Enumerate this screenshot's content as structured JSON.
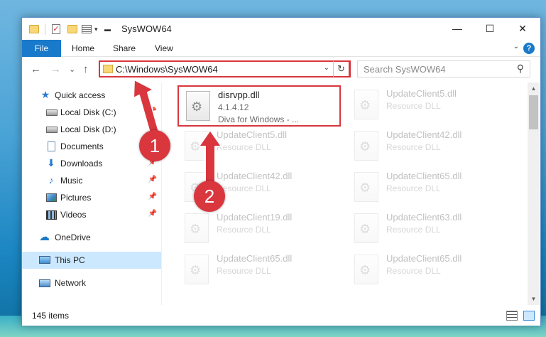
{
  "window": {
    "title": "SysWOW64",
    "minimize_glyph": "—",
    "maximize_glyph": "☐",
    "close_glyph": "✕"
  },
  "ribbon": {
    "tabs": [
      "File",
      "Home",
      "Share",
      "View"
    ],
    "help_glyph": "?",
    "collapse_glyph": "⌄"
  },
  "nav": {
    "back_glyph": "←",
    "forward_glyph": "→",
    "recent_glyph": "⌄",
    "up_glyph": "↑",
    "address": "C:\\Windows\\SysWOW64",
    "address_dropdown_glyph": "⌄",
    "refresh_glyph": "↻",
    "search_placeholder": "Search SysWOW64",
    "search_glyph": "⚲"
  },
  "sidebar": {
    "items": [
      {
        "label": "Quick access",
        "icon": "star-icon",
        "glyph": "★",
        "pinned": false
      },
      {
        "label": "Local Disk (C:)",
        "icon": "drive-icon",
        "glyph": "",
        "pinned": true
      },
      {
        "label": "Local Disk (D:)",
        "icon": "drive-icon",
        "glyph": "",
        "pinned": false
      },
      {
        "label": "Documents",
        "icon": "document-icon",
        "glyph": "",
        "pinned": false
      },
      {
        "label": "Downloads",
        "icon": "download-icon",
        "glyph": "⬇",
        "pinned": true
      },
      {
        "label": "Music",
        "icon": "music-icon",
        "glyph": "♪",
        "pinned": true
      },
      {
        "label": "Pictures",
        "icon": "pictures-icon",
        "glyph": "",
        "pinned": true
      },
      {
        "label": "Videos",
        "icon": "videos-icon",
        "glyph": "",
        "pinned": true
      },
      {
        "label": "OneDrive",
        "icon": "cloud-icon",
        "glyph": "☁",
        "pinned": false
      },
      {
        "label": "This PC",
        "icon": "computer-icon",
        "glyph": "",
        "pinned": false,
        "selected": true
      },
      {
        "label": "Network",
        "icon": "network-icon",
        "glyph": "",
        "pinned": false
      }
    ],
    "pin_glyph": "📌"
  },
  "files": [
    {
      "name": "disrvpp.dll",
      "line2": "4.1.4.12",
      "line3": "Diva for Windows - ...",
      "highlighted": true
    },
    {
      "name": "UpdateClient5.dll",
      "line2": "Resource DLL",
      "line3": ""
    },
    {
      "name": "UpdateClient5.dll",
      "line2": "Resource DLL",
      "line3": ""
    },
    {
      "name": "UpdateClient42.dll",
      "line2": "Resource DLL",
      "line3": ""
    },
    {
      "name": "UpdateClient42.dll",
      "line2": "Resource DLL",
      "line3": ""
    },
    {
      "name": "UpdateClient65.dll",
      "line2": "Resource DLL",
      "line3": ""
    },
    {
      "name": "UpdateClient19.dll",
      "line2": "Resource DLL",
      "line3": ""
    },
    {
      "name": "UpdateClient63.dll",
      "line2": "Resource DLL",
      "line3": ""
    },
    {
      "name": "UpdateClient65.dll",
      "line2": "Resource DLL",
      "line3": ""
    },
    {
      "name": "UpdateClient65.dll",
      "line2": "Resource DLL",
      "line3": ""
    }
  ],
  "file_icon_glyph": "⚙",
  "status": {
    "item_count": "145 items"
  },
  "annotations": {
    "step1": "1",
    "step2": "2",
    "color": "#d9363e"
  },
  "scrollbar": {
    "up_glyph": "▲",
    "down_glyph": "▼"
  }
}
